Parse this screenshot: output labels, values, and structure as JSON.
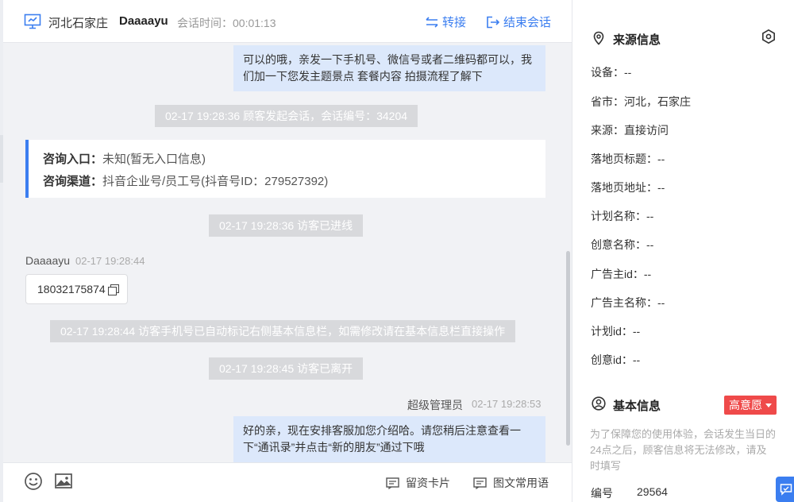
{
  "header": {
    "title": "河北石家庄",
    "visitor": "Daaaayu",
    "session_time": "会话时间：00:01:13",
    "transfer_label": "转接",
    "end_label": "结束会话"
  },
  "messages": {
    "agent_msg_1": "可以的哦，亲发一下手机号、微信号或者二维码都可以，我们加一下您发主题景点 套餐内容 拍摄流程了解下",
    "sys_session_start": "02-17 19:28:36 顾客发起会话，会话编号：34204",
    "consult_entry_label": "咨询入口：",
    "consult_entry_value": "未知(暂无入口信息)",
    "consult_channel_label": "咨询渠道：",
    "consult_channel_value": "抖音企业号/员工号(抖音号ID：279527392)",
    "sys_visitor_online": "02-17 19:28:36 访客已进线",
    "visitor_name": "Daaaayu",
    "visitor_time": "02-17 19:28:44",
    "visitor_phone": "18032175874",
    "sys_phone_marked": "02-17 19:28:44 访客手机号已自动标记右侧基本信息栏，如需修改请在基本信息栏直接操作",
    "sys_visitor_left": "02-17 19:28:45 访客已离开",
    "agent_name": "超级管理员",
    "agent_time": "02-17 19:28:53",
    "agent_msg_2": "好的亲，现在安排客服加您介绍哈。请您稍后注意查看一下“通讯录”并点击“新的朋友”通过下哦"
  },
  "footer": {
    "card_label": "留资卡片",
    "phrases_label": "图文常用语"
  },
  "side": {
    "source_title": "来源信息",
    "source_fields": [
      "设备：--",
      "省市：河北，石家庄",
      "来源：直接访问",
      "落地页标题：--",
      "落地页地址：--",
      "计划名称：--",
      "创意名称：--",
      "广告主id：--",
      "广告主名称：--",
      "计划id：--",
      "创意id：--"
    ],
    "basic_title": "基本信息",
    "intent_label": "高意愿",
    "notice": "为了保障您的使用体验，会话发生当日的24点之后，顾客信息将无法修改，请及时填写",
    "id_label": "编号",
    "id_value": "29564"
  },
  "colors": {
    "accent": "#3b7ef0",
    "agent_bubble": "#dce8fb",
    "system_pill": "#d8d9dc",
    "intent_badge": "#ef4a4a",
    "chat_bg": "#f1f2f5"
  },
  "icons": {
    "header": "monitor-icon",
    "transfer": "transfer-arrows-icon",
    "end": "exit-icon",
    "copy": "copy-icon",
    "emoji": "smile-icon",
    "image": "image-icon",
    "card": "card-icon",
    "phrases": "phrases-icon",
    "location": "location-pin-icon",
    "settings": "hexagon-gear-icon",
    "user": "user-circle-icon",
    "float": "chat-float-icon"
  }
}
